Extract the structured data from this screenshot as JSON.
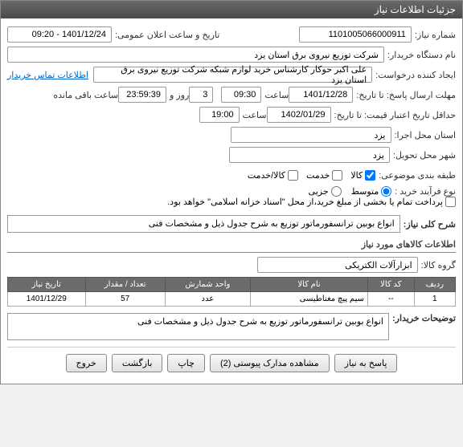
{
  "title": "جزئیات اطلاعات نیاز",
  "labels": {
    "need_no": "شماره نیاز:",
    "announce_dt": "تاریخ و ساعت اعلان عمومی:",
    "buyer_org": "نام دستگاه خریدار:",
    "requester": "ایجاد کننده درخواست:",
    "deadline": "مهلت ارسال پاسخ: تا تاریخ:",
    "hour": "ساعت",
    "day": "روز و",
    "remaining": "ساعت باقی مانده",
    "validity": "حداقل تاریخ اعتبار قیمت: تا تاریخ:",
    "exec_province": "استان محل اجرا:",
    "delivery_city": "شهر محل تحویل:",
    "category": "طبقه بندی موضوعی:",
    "purchase_type": "نوع فرآیند خرید :",
    "treasury_note": "پرداخت تمام یا بخشی از مبلغ خرید،از محل \"اسناد خزانه اسلامی\" خواهد بود.",
    "contact_link": "اطلاعات تماس خریدار",
    "desc_title": "شرح کلی نیاز:",
    "goods_info": "اطلاعات کالاهای مورد نیاز",
    "group": "گروه کالا:",
    "buyer_notes": "توضیحات خریدار:"
  },
  "values": {
    "need_no": "1101005066000911",
    "announce_dt": "1401/12/24 - 09:20",
    "buyer_org": "شرکت توزیع نیروی برق استان یزد",
    "requester": "علی اکبر  حوکار  کارشناس خرید لوازم شبکه  شرکت توزیع نیروی برق استان یزد",
    "deadline_date": "1401/12/28",
    "deadline_hour": "09:30",
    "days": "3",
    "remain_time": "23:59:39",
    "validity_date": "1402/01/29",
    "validity_hour": "19:00",
    "province": "یزد",
    "city": "یزد",
    "desc": "انواع بوبین ترانسفورماتور توزیع به شرح جدول ذیل و مشخصات فنی",
    "group": "ابزارآلات الکتریکی",
    "buyer_notes": "انواع بوبین ترانسفورماتور توزیع به شرح جدول ذیل و مشخصات فنی"
  },
  "category_opts": {
    "goods": "کالا",
    "service": "خدمت",
    "both": "کالا/خدمت"
  },
  "ptype_opts": {
    "medium": "متوسط",
    "minor": "جزیی"
  },
  "table": {
    "headers": {
      "row": "ردیف",
      "code": "کد کالا",
      "name": "نام کالا",
      "unit": "واحد شمارش",
      "qty": "تعداد / مقدار",
      "date": "تاریخ نیاز"
    },
    "rows": [
      {
        "row": "1",
        "code": "--",
        "name": "سیم پیچ مغناطیسی",
        "unit": "عدد",
        "qty": "57",
        "date": "1401/12/29"
      }
    ]
  },
  "buttons": {
    "reply": "پاسخ به نیاز",
    "attach": "مشاهده مدارک پیوستی (2)",
    "print": "چاپ",
    "back": "بازگشت",
    "exit": "خروج"
  }
}
